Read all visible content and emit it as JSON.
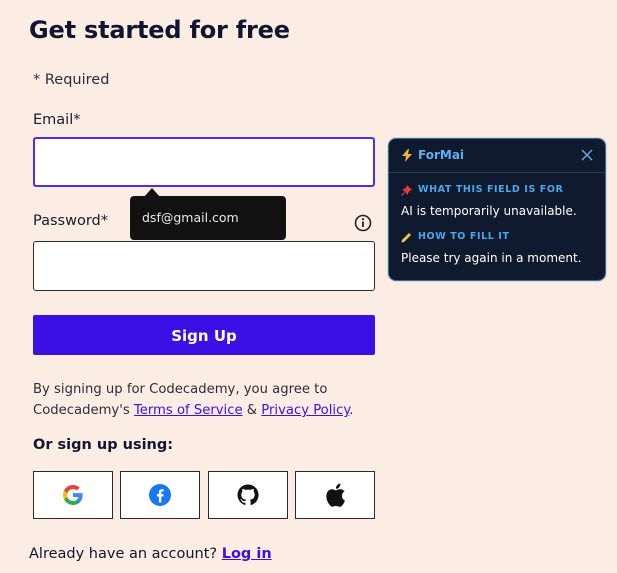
{
  "page": {
    "title": "Get started for free",
    "required": "* Required"
  },
  "email": {
    "label": "Email*",
    "value": "",
    "suggestion": "dsf@gmail.com"
  },
  "password": {
    "label": "Password*",
    "value": ""
  },
  "signup_button": "Sign Up",
  "terms": {
    "prefix": "By signing up for Codecademy, you agree to Codecademy's ",
    "tos_link": "Terms of Service",
    "amp": " & ",
    "privacy_link": "Privacy Policy",
    "suffix": "."
  },
  "social": {
    "label": "Or sign up using:",
    "providers": [
      "google-icon",
      "facebook-icon",
      "github-icon",
      "apple-icon"
    ]
  },
  "login": {
    "prompt": "Already have an account? ",
    "link": "Log in"
  },
  "formai": {
    "title": "ForMai",
    "section1_title": "WHAT THIS FIELD IS FOR",
    "section1_text": "AI is temporarily unavailable.",
    "section2_title": "HOW TO FILL IT",
    "section2_text": "Please try again in a moment."
  },
  "colors": {
    "background": "#fcede4",
    "accent": "#3a10e5",
    "panel_bg": "#0f1a2e",
    "panel_accent": "#4aa8e8"
  }
}
